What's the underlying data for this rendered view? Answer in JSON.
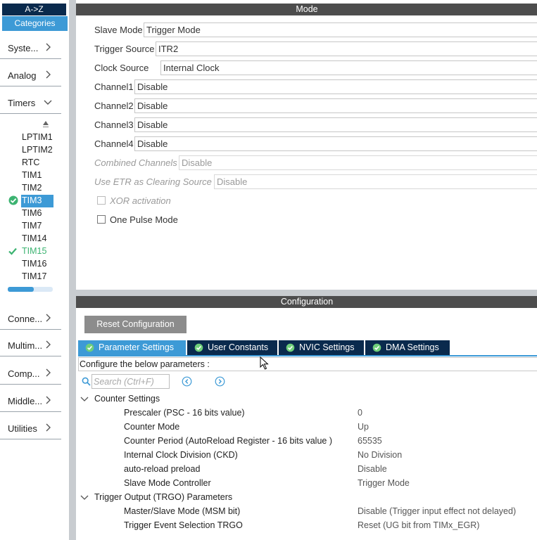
{
  "sidebar": {
    "az_label": "A->Z",
    "categories_label": "Categories",
    "categories": [
      {
        "label": "Syste..."
      },
      {
        "label": "Analog"
      },
      {
        "label": "Timers"
      },
      {
        "label": "Conne..."
      },
      {
        "label": "Multim..."
      },
      {
        "label": "Comp..."
      },
      {
        "label": "Middle..."
      },
      {
        "label": "Utilities"
      }
    ],
    "timers": [
      "LPTIM1",
      "LPTIM2",
      "RTC",
      "TIM1",
      "TIM2",
      "TIM3",
      "TIM6",
      "TIM7",
      "TIM14",
      "TIM15",
      "TIM16",
      "TIM17"
    ],
    "scroll_fraction": 0.58,
    "selected_color": "#3d9ad6",
    "configured_color": "#3cb371"
  },
  "mode": {
    "title": "Mode",
    "fields": [
      {
        "label": "Slave Mode",
        "value": "Trigger Mode"
      },
      {
        "label": "Trigger Source",
        "value": "ITR2"
      },
      {
        "label": "Clock Source",
        "value": "Internal Clock"
      },
      {
        "label": "Channel1",
        "value": "Disable"
      },
      {
        "label": "Channel2",
        "value": "Disable"
      },
      {
        "label": "Channel3",
        "value": "Disable"
      },
      {
        "label": "Channel4",
        "value": "Disable"
      },
      {
        "label": "Combined Channels",
        "value": "Disable"
      },
      {
        "label": "Use ETR as Clearing Source",
        "value": "Disable"
      }
    ],
    "xor_label": "XOR activation",
    "one_pulse_label": "One Pulse Mode"
  },
  "config": {
    "title": "Configuration",
    "reset_label": "Reset Configuration",
    "tabs": [
      {
        "label": "Parameter Settings"
      },
      {
        "label": "User Constants"
      },
      {
        "label": "NVIC Settings"
      },
      {
        "label": "DMA Settings"
      }
    ],
    "hint": "Configure the below parameters :",
    "search_placeholder": "Search (Ctrl+F)",
    "groups": [
      {
        "label": "Counter Settings",
        "params": [
          {
            "name": "Prescaler (PSC - 16 bits value)",
            "value": "0"
          },
          {
            "name": "Counter Mode",
            "value": "Up"
          },
          {
            "name": "Counter Period (AutoReload Register - 16 bits value )",
            "value": "65535"
          },
          {
            "name": "Internal Clock Division (CKD)",
            "value": "No Division"
          },
          {
            "name": "auto-reload preload",
            "value": "Disable"
          },
          {
            "name": "Slave Mode Controller",
            "value": "Trigger Mode"
          }
        ]
      },
      {
        "label": "Trigger Output (TRGO) Parameters",
        "params": [
          {
            "name": "Master/Slave Mode (MSM bit)",
            "value": "Disable (Trigger input effect not delayed)"
          },
          {
            "name": "Trigger Event Selection TRGO",
            "value": "Reset (UG bit from TIMx_EGR)"
          }
        ]
      }
    ]
  }
}
